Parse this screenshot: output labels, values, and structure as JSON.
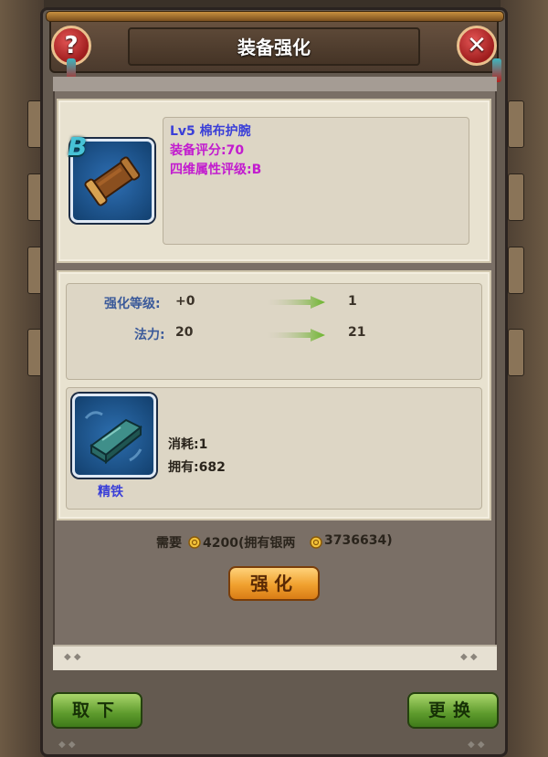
{
  "dialog": {
    "title": "装备强化",
    "help_symbol": "?",
    "close_symbol": "✕"
  },
  "equipment": {
    "grade": "B",
    "name_line": "Lv5 棉布护腕",
    "score_line": "装备评分:70",
    "attr_grade_line": "四维属性评级:B",
    "icon": "bracer-icon"
  },
  "stats": [
    {
      "label": "强化等级:",
      "current": "+0",
      "next": "1"
    },
    {
      "label": "法力:",
      "current": "20",
      "next": "21"
    }
  ],
  "material": {
    "name": "精铁",
    "cost_line": "消耗:1",
    "owned_line": "拥有:682",
    "icon": "iron-ingot-icon"
  },
  "requirement": {
    "prefix": "需要",
    "cost": "4200(拥有银两",
    "owned": "3736634)",
    "coin_icon": "coin-icon"
  },
  "buttons": {
    "enhance": "强化",
    "remove": "取下",
    "replace": "更换"
  },
  "colors": {
    "name_blue": "#3a3fd8",
    "magenta": "#c21bcf",
    "label_blue": "#3b5a9a",
    "stat_value": "#3a3228",
    "arrow_green": "#6bb52c"
  }
}
